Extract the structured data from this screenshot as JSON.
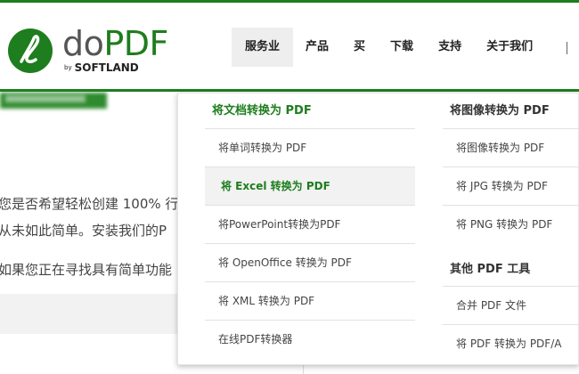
{
  "brand": {
    "name_do": "do",
    "name_pdf": "PDF",
    "by": "by",
    "company": "SOFTLAND",
    "logo_icon": "pen-circle-logo-icon",
    "accent_color": "#1e7d1e"
  },
  "nav": {
    "items": [
      "服务业",
      "产品",
      "买",
      "下载",
      "支持",
      "关于我们"
    ],
    "active": "服务业"
  },
  "page": {
    "line1": "您是否希望轻松创建 100% 行",
    "line2": "从未如此简单。安装我们的P",
    "line3": "如果您正在寻找具有简单功能"
  },
  "dropdown": {
    "col1": {
      "heading": "将文档转换为 PDF",
      "items": [
        "将单词转换为 PDF",
        "将 Excel 转换为 PDF",
        "将PowerPoint转换为PDF",
        "将 OpenOffice 转换为 PDF",
        "将 XML 转换为 PDF",
        "在线PDF转换器"
      ],
      "active_item": "将 Excel 转换为 PDF"
    },
    "col2": {
      "heading": "将图像转换为 PDF",
      "items": [
        "将图像转换为 PDF",
        "将 JPG 转换为 PDF",
        "将 PNG 转换为 PDF"
      ],
      "heading2": "其他 PDF 工具",
      "items2": [
        "合并 PDF 文件",
        "将 PDF 转换为 PDF/A"
      ]
    }
  }
}
